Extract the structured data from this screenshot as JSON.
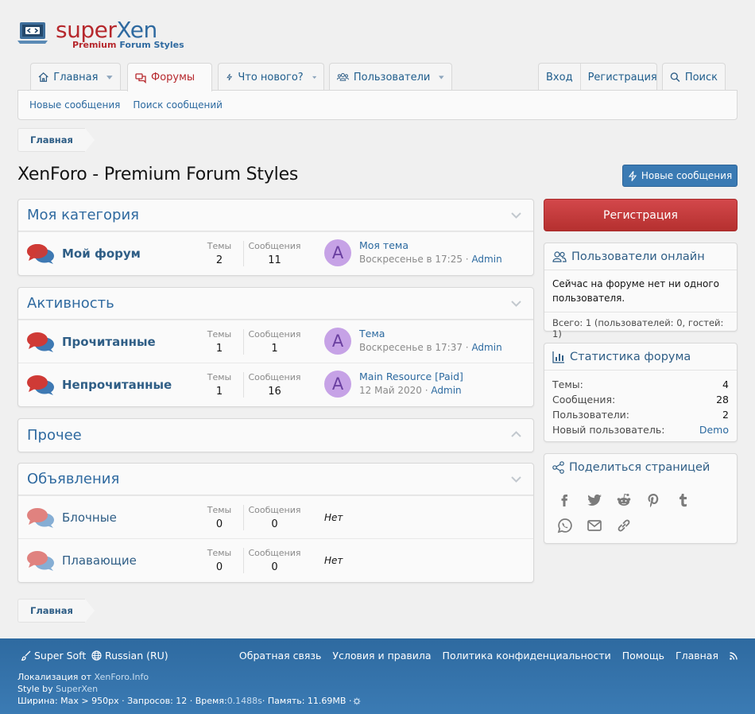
{
  "logo": {
    "super": "super",
    "xen": "Xen",
    "sub1": "Premium ",
    "sub2": "Forum Styles"
  },
  "nav": {
    "home": "Главная",
    "forums": "Форумы",
    "whats_new": "Что нового?",
    "members": "Пользователи",
    "login": "Вход",
    "register": "Регистрация",
    "search": "Поиск"
  },
  "subnav": {
    "new_posts": "Новые сообщения",
    "search_posts": "Поиск сообщений"
  },
  "breadcrumb": {
    "home": "Главная"
  },
  "page": {
    "title": "XenForo - Premium Forum Styles",
    "new_posts_button": "Новые сообщения"
  },
  "stat_labels": {
    "threads": "Темы",
    "messages": "Сообщения"
  },
  "categories": [
    {
      "title": "Моя категория",
      "nodes": [
        {
          "title": "Мой форум",
          "threads": "2",
          "messages": "11",
          "avatar": "A",
          "last_title": "Моя тема",
          "last_date": "Воскресенье в 17:25",
          "last_user": "Admin"
        }
      ]
    },
    {
      "title": "Активность",
      "nodes": [
        {
          "title": "Прочитанные",
          "threads": "1",
          "messages": "1",
          "avatar": "A",
          "last_title": "Тема",
          "last_date": "Воскресенье в 17:37",
          "last_user": "Admin"
        },
        {
          "title": "Непрочитанные",
          "threads": "1",
          "messages": "16",
          "avatar": "A",
          "last_title": "Main Resource [Paid]",
          "last_date": "12 Май 2020",
          "last_user": "Admin"
        }
      ]
    },
    {
      "title": "Прочее"
    },
    {
      "title": "Объявления",
      "nodes": [
        {
          "title": "Блочные",
          "threads": "0",
          "messages": "0",
          "none": "Нет"
        },
        {
          "title": "Плавающие",
          "threads": "0",
          "messages": "0",
          "none": "Нет"
        }
      ]
    }
  ],
  "sidebar": {
    "register_button": "Регистрация",
    "online": {
      "title": "Пользователи онлайн",
      "text": "Сейчас на форуме нет ни одного пользователя.",
      "total": "Всего: 1 (пользователей: 0, гостей: 1)"
    },
    "stats": {
      "title": "Статистика форума",
      "rows": [
        {
          "label": "Темы:",
          "value": "4"
        },
        {
          "label": "Сообщения:",
          "value": "28"
        },
        {
          "label": "Пользователи:",
          "value": "2"
        },
        {
          "label": "Новый пользователь:",
          "value": "Demo"
        }
      ]
    },
    "share": {
      "title": "Поделиться страницей",
      "icons": [
        "facebook-icon",
        "twitter-icon",
        "reddit-icon",
        "pinterest-icon",
        "tumblr-icon",
        "whatsapp-icon",
        "email-icon",
        "link-icon"
      ]
    }
  },
  "footer": {
    "super_soft": "Super Soft",
    "language": "Russian (RU)",
    "links": [
      "Обратная связь",
      "Условия и правила",
      "Политика конфиденциальности",
      "Помощь",
      "Главная"
    ],
    "localization_prefix": "Локализация от ",
    "localization_link": "XenForo.Info",
    "style_prefix": "Style by ",
    "style_link": "SuperXen",
    "debug_prefix": "Ширина: Max > 950px · Запросов: 12 · Время: ",
    "debug_time": "0.1488s",
    "debug_suffix": " · Память: 11.69MB · "
  },
  "colors": {
    "accent": "#2f6aa0",
    "brand_red": "#b6282d",
    "footer": "#2e6aa0",
    "register": "#c63a3c",
    "avatar": "#c6a2e6"
  }
}
